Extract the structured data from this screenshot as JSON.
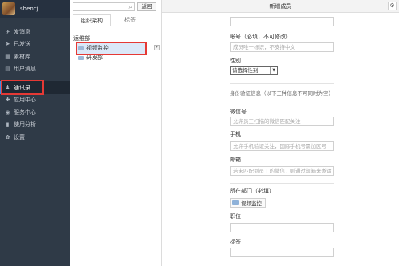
{
  "sidebar": {
    "username": "shencj",
    "items": [
      {
        "icon": "send-icon",
        "glyph": "✈",
        "label": "发消息"
      },
      {
        "icon": "sent-icon",
        "glyph": "➤",
        "label": "已发送"
      },
      {
        "icon": "material-icon",
        "glyph": "▦",
        "label": "素材库"
      },
      {
        "icon": "user-message-icon",
        "glyph": "▤",
        "label": "用户消息"
      },
      {
        "icon": "contacts-icon",
        "glyph": "♟",
        "label": "通讯录"
      },
      {
        "icon": "app-center-icon",
        "glyph": "✚",
        "label": "应用中心"
      },
      {
        "icon": "service-center-icon",
        "glyph": "◉",
        "label": "服务中心"
      },
      {
        "icon": "analytics-icon",
        "glyph": "▮",
        "label": "使用分析"
      },
      {
        "icon": "settings-icon",
        "glyph": "✿",
        "label": "设置"
      }
    ]
  },
  "tree": {
    "search_placeholder": "",
    "back_label": "返回",
    "tabs": [
      "组织架构",
      "标签"
    ],
    "root": "运维部",
    "nodes": [
      "视频监控",
      "研发部"
    ],
    "handle_glyph": "▸"
  },
  "main": {
    "title": "新增成员",
    "account_label": "帐号（必填，不可修改）",
    "account_placeholder": "成员唯一标识，不支持中文",
    "gender_label": "性别",
    "gender_value": "请选择性别",
    "verify_label": "身份验证信息（以下三种信息不可同时为空）",
    "wechat_label": "微信号",
    "wechat_placeholder": "允许员工扫描的微信匹配关注",
    "phone_label": "手机",
    "phone_placeholder": "允许手机验证关注，国际手机号需加区号",
    "email_label": "邮箱",
    "email_placeholder": "若未匹配到员工的微信，则通过邮箱来邀请",
    "dept_label": "所在部门（必填）",
    "dept_value": "视频监控",
    "position_label": "职位",
    "tags_label": "标签"
  },
  "colors": {
    "sidebar_bg": "#2f3a47",
    "highlight": "#e53935",
    "accent": "#3f8be0"
  }
}
